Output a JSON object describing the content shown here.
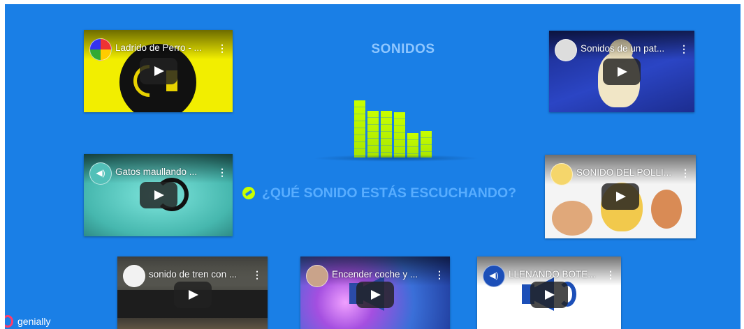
{
  "title": "SONIDOS",
  "question": "¿QUÉ SONIDO ESTÁS ESCUCHANDO?",
  "branding": "genially",
  "colors": {
    "background": "#1a7fe6",
    "accent": "#c8ff00",
    "title": "#8fc7ff",
    "question": "#58adff"
  },
  "equalizer_levels": [
    0.91,
    0.74,
    0.74,
    0.72,
    0.39,
    0.42
  ],
  "videos": [
    {
      "title": "Ladrido de Perro - ...",
      "channel_icon": "colorful-logo-icon"
    },
    {
      "title": "Sonidos de un pat...",
      "channel_icon": "animals-icon"
    },
    {
      "title": "Gatos maullando ...",
      "channel_icon": "speaker-icon"
    },
    {
      "title": "SONIDO DEL POLLI...",
      "channel_icon": "chick-icon"
    },
    {
      "title": "sonido de tren con ...",
      "channel_icon": "pen-icon"
    },
    {
      "title": "Encender coche y ...",
      "channel_icon": "portrait-icon"
    },
    {
      "title": "LLENANDO BOTE...",
      "channel_icon": "speaker-icon"
    }
  ]
}
